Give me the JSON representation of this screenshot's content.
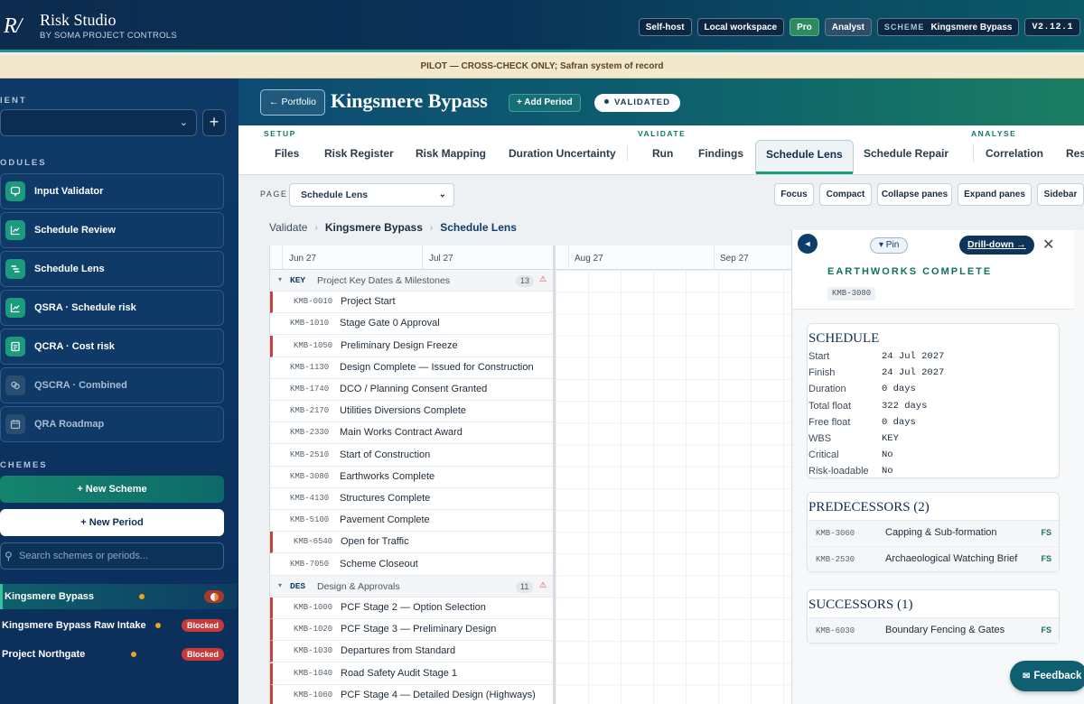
{
  "app": {
    "logo_text": "R/",
    "title": "Risk Studio",
    "subtitle": "BY SOMA PROJECT CONTROLS",
    "chips": {
      "selfhost": "Self-host",
      "workspace": "Local workspace",
      "pro": "Pro",
      "analyst": "Analyst",
      "scheme_label": "SCHEME",
      "scheme_value": "Kingsmere Bypass",
      "version": "V2.12.1"
    }
  },
  "banner": "PILOT — CROSS-CHECK ONLY; Safran system of record",
  "sidebar": {
    "client_label": "IENT",
    "modules_label": "ODULES",
    "schemes_label": "CHEMES",
    "modules": [
      {
        "label": "Input Validator",
        "icon": "chat-icon"
      },
      {
        "label": "Schedule Review",
        "icon": "chart-icon"
      },
      {
        "label": "Schedule Lens",
        "icon": "lines-icon"
      },
      {
        "label": "QSRA · Schedule risk",
        "icon": "chart-icon"
      },
      {
        "label": "QCRA · Cost risk",
        "icon": "doc-icon"
      },
      {
        "label": "QSCRA · Combined",
        "icon": "link-icon"
      },
      {
        "label": "QRA Roadmap",
        "icon": "calendar-icon"
      }
    ],
    "new_scheme": "+ New Scheme",
    "new_period": "+ New Period",
    "search_placeholder": "Search schemes or periods...",
    "schemes": [
      {
        "name": "Kingsmere Bypass",
        "status": ""
      },
      {
        "name": "Kingsmere Bypass Raw Intake",
        "status": "Blocked"
      },
      {
        "name": "Project Northgate",
        "status": "Blocked"
      }
    ]
  },
  "header": {
    "back": "← Portfolio",
    "title": "Kingsmere Bypass",
    "add_period": "+ Add Period",
    "status": "VALIDATED"
  },
  "tabs": {
    "groups": {
      "setup": "SETUP",
      "validate": "VALIDATE",
      "analyse": "ANALYSE"
    },
    "items": [
      "Files",
      "Risk Register",
      "Risk Mapping",
      "Duration Uncertainty",
      "Run",
      "Findings",
      "Schedule Lens",
      "Schedule Repair",
      "Correlation",
      "Res"
    ]
  },
  "toolbar": {
    "page_label": "PAGE",
    "page_value": "Schedule Lens",
    "buttons": [
      "Focus",
      "Compact",
      "Collapse panes",
      "Expand panes",
      "Sidebar"
    ]
  },
  "breadcrumb": [
    "Validate",
    "Kingsmere Bypass",
    "Schedule Lens"
  ],
  "grid": {
    "timeline": [
      "Jun 27",
      "Jul 27",
      "Aug 27",
      "Sep 27"
    ],
    "groups": [
      {
        "code": "KEY",
        "name": "Project Key Dates & Milestones",
        "count": "13",
        "warn": "⚠"
      },
      {
        "code": "DES",
        "name": "Design & Approvals",
        "count": "11",
        "warn": "⚠"
      }
    ],
    "rows_key": [
      {
        "code": "KMB-0010",
        "name": "Project Start"
      },
      {
        "code": "KMB-1010",
        "name": "Stage Gate 0 Approval"
      },
      {
        "code": "KMB-1050",
        "name": "Preliminary Design Freeze"
      },
      {
        "code": "KMB-1130",
        "name": "Design Complete — Issued for Construction"
      },
      {
        "code": "KMB-1740",
        "name": "DCO / Planning Consent Granted"
      },
      {
        "code": "KMB-2170",
        "name": "Utilities Diversions Complete"
      },
      {
        "code": "KMB-2330",
        "name": "Main Works Contract Award"
      },
      {
        "code": "KMB-2510",
        "name": "Start of Construction"
      },
      {
        "code": "KMB-3080",
        "name": "Earthworks Complete"
      },
      {
        "code": "KMB-4130",
        "name": "Structures Complete"
      },
      {
        "code": "KMB-5100",
        "name": "Pavement Complete"
      },
      {
        "code": "KMB-6540",
        "name": "Open for Traffic"
      },
      {
        "code": "KMB-7050",
        "name": "Scheme Closeout"
      }
    ],
    "rows_des": [
      {
        "code": "KMB-1000",
        "name": "PCF Stage 2 — Option Selection"
      },
      {
        "code": "KMB-1020",
        "name": "PCF Stage 3 — Preliminary Design"
      },
      {
        "code": "KMB-1030",
        "name": "Departures from Standard"
      },
      {
        "code": "KMB-1040",
        "name": "Road Safety Audit Stage 1"
      },
      {
        "code": "KMB-1060",
        "name": "PCF Stage 4 — Detailed Design (Highways)"
      }
    ]
  },
  "detail": {
    "back": "◄",
    "pin": "▾ Pin",
    "drill": "Drill-down →",
    "close": "✕",
    "title": "EARTHWORKS COMPLETE",
    "code": "KMB-3080",
    "schedule_h": "SCHEDULE",
    "schedule": [
      {
        "k": "Start",
        "v": "24 Jul 2027"
      },
      {
        "k": "Finish",
        "v": "24 Jul 2027"
      },
      {
        "k": "Duration",
        "v": "0 days"
      },
      {
        "k": "Total float",
        "v": "322 days"
      },
      {
        "k": "Free float",
        "v": "0 days"
      },
      {
        "k": "WBS",
        "v": "KEY"
      },
      {
        "k": "Critical",
        "v": "No"
      },
      {
        "k": "Risk-loadable",
        "v": "No"
      }
    ],
    "pred_h": "PREDECESSORS (2)",
    "preds": [
      {
        "code": "KMB-3060",
        "name": "Capping & Sub-formation",
        "type": "FS"
      },
      {
        "code": "KMB-2530",
        "name": "Archaeological Watching Brief",
        "type": "FS"
      }
    ],
    "succ_h": "SUCCESSORS (1)",
    "succs": [
      {
        "code": "KMB-6030",
        "name": "Boundary Fencing & Gates",
        "type": "FS"
      }
    ]
  },
  "feedback": "Feedback"
}
